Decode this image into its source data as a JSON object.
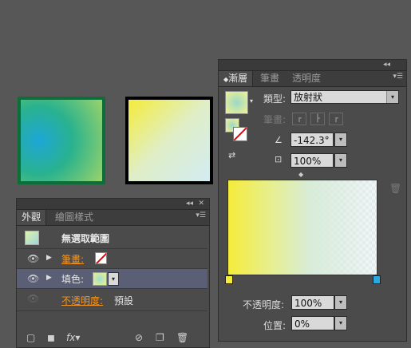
{
  "appearance": {
    "tab_active": "外觀",
    "tab_other": "繪圖樣式",
    "title": "無選取範圍",
    "rows": [
      {
        "label": "筆畫:"
      },
      {
        "label": "填色:"
      },
      {
        "label": "不透明度:",
        "value": "預設"
      }
    ]
  },
  "gradient": {
    "tabs": [
      "漸層",
      "筆畫",
      "透明度"
    ],
    "type_label": "類型:",
    "type_value": "放射狀",
    "stroke_label": "筆畫:",
    "angle_value": "-142.3°",
    "aspect_value": "100%",
    "opacity_label": "不透明度:",
    "opacity_value": "100%",
    "location_label": "位置:",
    "location_value": "0%"
  },
  "colors": {
    "accent_orange": "#f7941d",
    "stop_yellow": "#f5ec3a",
    "stop_blue": "#2ba9df"
  }
}
